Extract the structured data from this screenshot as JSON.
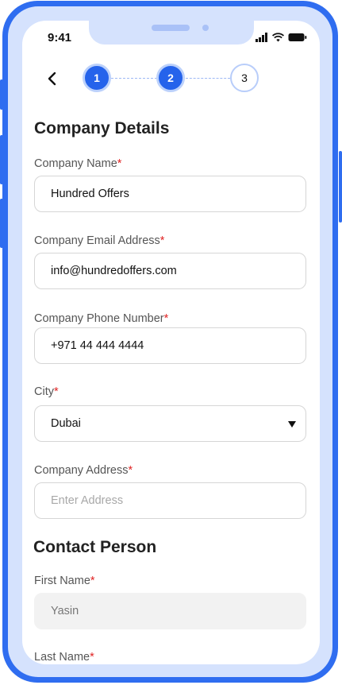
{
  "status_bar": {
    "time": "9:41"
  },
  "stepper": {
    "steps": [
      "1",
      "2",
      "3"
    ],
    "current": 2
  },
  "company_details": {
    "title": "Company Details",
    "company_name": {
      "label": "Company Name",
      "value": "Hundred Offers"
    },
    "company_email": {
      "label": "Company Email Address",
      "value": "info@hundredoffers.com"
    },
    "company_phone": {
      "label": "Company Phone Number",
      "value": "+971 44 444 4444"
    },
    "city": {
      "label": "City",
      "value": "Dubai"
    },
    "company_address": {
      "label": "Company Address",
      "placeholder": "Enter Address"
    }
  },
  "contact_person": {
    "title": "Contact Person",
    "first_name": {
      "label": "First Name",
      "value": "Yasin"
    },
    "last_name": {
      "label": "Last Name"
    }
  },
  "required_marker": "*",
  "colors": {
    "accent": "#2563eb",
    "frame": "#2f6df0",
    "required": "#e02424"
  }
}
